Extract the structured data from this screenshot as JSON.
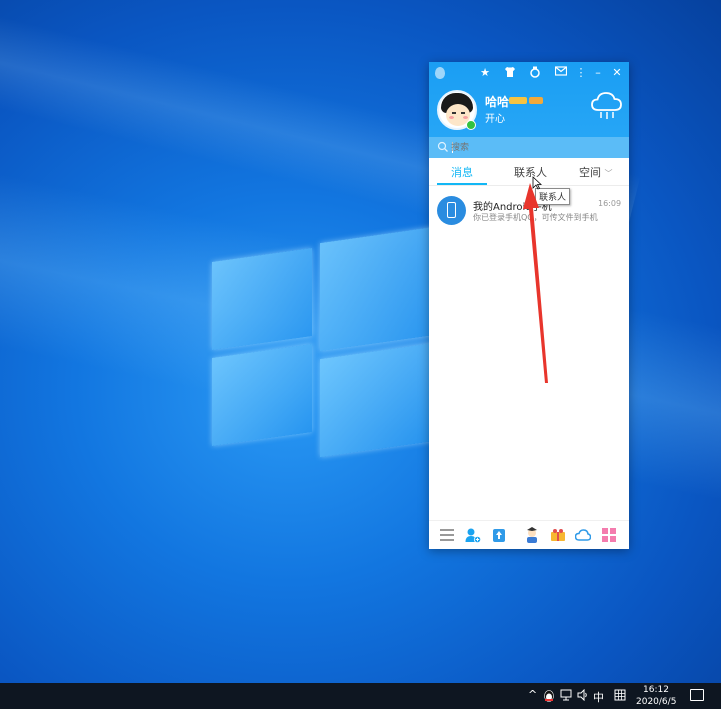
{
  "qq": {
    "nickname": "哈哈",
    "signature": "开心",
    "search_placeholder": "搜索",
    "tabs": [
      {
        "label": "消息",
        "active": true
      },
      {
        "label": "联系人",
        "active": false
      },
      {
        "label": "空间",
        "active": false
      }
    ],
    "tab_tooltip": "联系人",
    "messages": [
      {
        "name": "我的Android手机",
        "time": "16:09",
        "preview": "你已登录手机QQ，可传文件到手机"
      }
    ],
    "colors": {
      "header": "#1a9ef3",
      "accent": "#12b7f5",
      "online": "#32c241"
    }
  },
  "taskbar": {
    "ime": "中",
    "time": "16:12",
    "date": "2020/6/5"
  }
}
